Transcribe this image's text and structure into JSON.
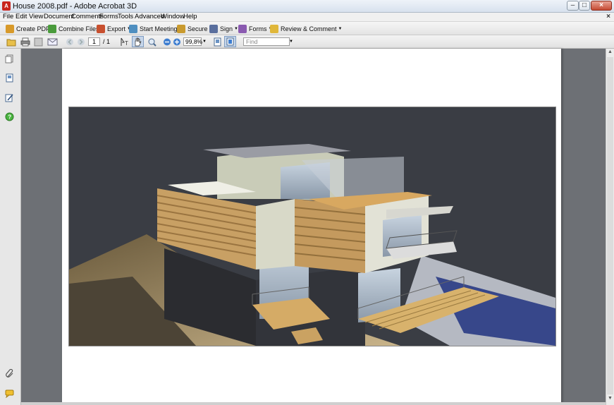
{
  "window": {
    "title": "House 2008.pdf - Adobe Acrobat 3D",
    "app_icon": "pdf-icon"
  },
  "menubar": {
    "items": [
      "File",
      "Edit",
      "View",
      "Document",
      "Comments",
      "Forms",
      "Tools",
      "Advanced",
      "Window",
      "Help"
    ],
    "close_symbol": "×"
  },
  "toolbar": {
    "tasks": [
      {
        "label": "Create PDF",
        "icon": "create-pdf-icon",
        "color": "#d89a2a"
      },
      {
        "label": "Combine Files",
        "icon": "combine-files-icon",
        "color": "#4a9b3c"
      },
      {
        "label": "Export",
        "icon": "export-icon",
        "color": "#c8502f"
      },
      {
        "label": "Start Meeting",
        "icon": "start-meeting-icon",
        "color": "#4f8fc0"
      },
      {
        "label": "Secure",
        "icon": "lock-icon",
        "color": "#c99a2e"
      },
      {
        "label": "Sign",
        "icon": "pen-icon",
        "color": "#5a6f9e"
      },
      {
        "label": "Forms",
        "icon": "forms-icon",
        "color": "#8a5ab0"
      },
      {
        "label": "Review & Comment",
        "icon": "review-comment-icon",
        "color": "#e0b73a"
      }
    ]
  },
  "navigation": {
    "current_page": "1",
    "page_count": "/ 1",
    "zoom": "99,8%",
    "find_placeholder": "Find"
  }
}
